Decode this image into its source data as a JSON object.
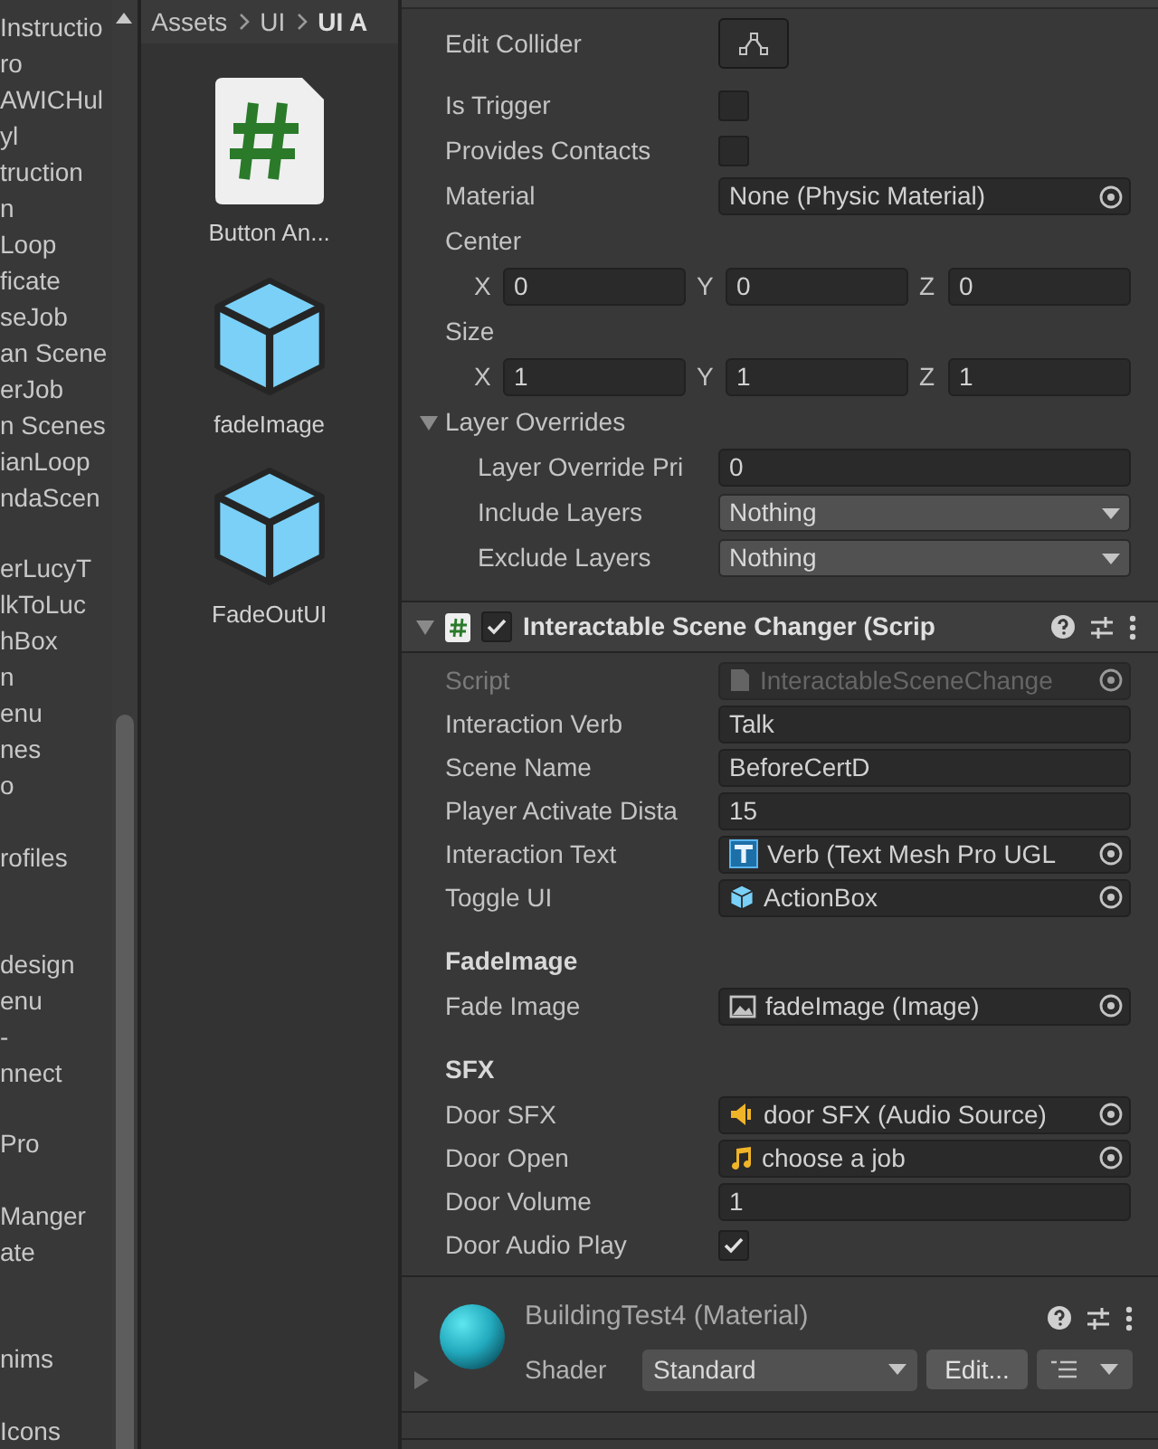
{
  "project_list": {
    "items": [
      {
        "kind": "text",
        "text": "Instructio"
      },
      {
        "kind": "text",
        "text": "ro"
      },
      {
        "kind": "text",
        "text": "AWICHul"
      },
      {
        "kind": "text",
        "text": "yl"
      },
      {
        "kind": "text",
        "text": "truction"
      },
      {
        "kind": "text",
        "text": "n"
      },
      {
        "kind": "text",
        "text": "Loop"
      },
      {
        "kind": "text",
        "text": "ficate"
      },
      {
        "kind": "text",
        "text": "seJob"
      },
      {
        "kind": "text",
        "text": "an Scene"
      },
      {
        "kind": "text",
        "text": "erJob"
      },
      {
        "kind": "text",
        "text": "n Scenes"
      },
      {
        "kind": "text",
        "text": "ianLoop"
      },
      {
        "kind": "text",
        "text": "ndaScen"
      },
      {
        "kind": "blank"
      },
      {
        "kind": "text",
        "text": "erLucyT"
      },
      {
        "kind": "text",
        "text": "lkToLuc"
      },
      {
        "kind": "text",
        "text": "hBox"
      },
      {
        "kind": "text",
        "text": "n"
      },
      {
        "kind": "text",
        "text": "enu"
      },
      {
        "kind": "text",
        "text": "nes"
      },
      {
        "kind": "text",
        "text": "o"
      },
      {
        "kind": "blank"
      },
      {
        "kind": "text",
        "text": "rofiles"
      },
      {
        "kind": "blank"
      },
      {
        "kind": "blank"
      },
      {
        "kind": "text",
        "text": "design"
      },
      {
        "kind": "text",
        "text": "enu"
      },
      {
        "kind": "text",
        "text": "-"
      },
      {
        "kind": "text",
        "text": "nnect"
      },
      {
        "kind": "blank"
      },
      {
        "kind": "text",
        "text": "Pro"
      },
      {
        "kind": "blank"
      },
      {
        "kind": "text",
        "text": "Manger"
      },
      {
        "kind": "text",
        "text": "ate"
      },
      {
        "kind": "blank"
      },
      {
        "kind": "blank"
      },
      {
        "kind": "text",
        "text": "nims"
      },
      {
        "kind": "blank"
      },
      {
        "kind": "text",
        "text": "Icons"
      }
    ]
  },
  "breadcrumb": [
    "Assets",
    "UI",
    "UI A"
  ],
  "assets": [
    {
      "name": "Button An...",
      "kind": "script"
    },
    {
      "name": "fadeImage",
      "kind": "prefab"
    },
    {
      "name": "FadeOutUI",
      "kind": "prefab"
    }
  ],
  "collider": {
    "rows": [
      {
        "kind": "edit_button",
        "label": "Edit Collider"
      },
      {
        "kind": "checkbox",
        "label": "Is Trigger",
        "checked": false
      },
      {
        "kind": "checkbox",
        "label": "Provides Contacts",
        "checked": false
      },
      {
        "kind": "object",
        "label": "Material",
        "value": {
          "name": "None (Physic Material)"
        },
        "disabled": false
      },
      {
        "kind": "vector",
        "label": "Center",
        "axes": [
          {
            "axis": "X",
            "value": "0"
          },
          {
            "axis": "Y",
            "value": "0"
          },
          {
            "axis": "Z",
            "value": "0"
          }
        ]
      },
      {
        "kind": "vector",
        "label": "Size",
        "axes": [
          {
            "axis": "X",
            "value": "1"
          },
          {
            "axis": "Y",
            "value": "1"
          },
          {
            "axis": "Z",
            "value": "1"
          }
        ]
      },
      {
        "kind": "foldout",
        "label": "Layer Overrides",
        "expanded": true,
        "children": [
          {
            "kind": "text",
            "label": "Layer Override Pri",
            "value": "0"
          },
          {
            "kind": "dropdown",
            "label": "Include Layers",
            "value": "Nothing"
          },
          {
            "kind": "dropdown",
            "label": "Exclude Layers",
            "value": "Nothing"
          }
        ]
      }
    ]
  },
  "component": {
    "title": "Interactable Scene Changer (Scrip",
    "expanded": true,
    "enabled": true,
    "rows": [
      {
        "kind": "object",
        "label": "Script",
        "value": {
          "kind": "script",
          "name": "InteractableSceneChange"
        },
        "disabled": true
      },
      {
        "kind": "text",
        "label": "Interaction Verb",
        "value": "Talk"
      },
      {
        "kind": "text",
        "label": "Scene Name",
        "value": "BeforeCertD"
      },
      {
        "kind": "text",
        "label": "Player Activate Dista",
        "value": "15"
      },
      {
        "kind": "object",
        "label": "Interaction Text",
        "value": {
          "kind": "text",
          "name": "Verb (Text Mesh Pro UGL"
        },
        "disabled": false
      },
      {
        "kind": "object",
        "label": "Toggle UI",
        "value": {
          "kind": "prefab",
          "name": "ActionBox"
        },
        "disabled": false
      },
      {
        "kind": "header",
        "label": "FadeImage"
      },
      {
        "kind": "object",
        "label": "Fade Image",
        "value": {
          "kind": "image",
          "name": "fadeImage (Image)"
        },
        "disabled": false
      },
      {
        "kind": "header",
        "label": "SFX"
      },
      {
        "kind": "object",
        "label": "Door SFX",
        "value": {
          "kind": "audio_source",
          "name": "door SFX (Audio Source)"
        },
        "disabled": false
      },
      {
        "kind": "object",
        "label": "Door Open",
        "value": {
          "kind": "audio_clip",
          "name": "choose a job"
        },
        "disabled": false
      },
      {
        "kind": "text",
        "label": "Door Volume",
        "value": "1"
      },
      {
        "kind": "checkbox",
        "label": "Door Audio Play",
        "checked": true
      }
    ]
  },
  "material": {
    "title": "BuildingTest4 (Material)",
    "expanded": false,
    "shader_label": "Shader",
    "shader": "Standard",
    "edit_button": "Edit..."
  }
}
